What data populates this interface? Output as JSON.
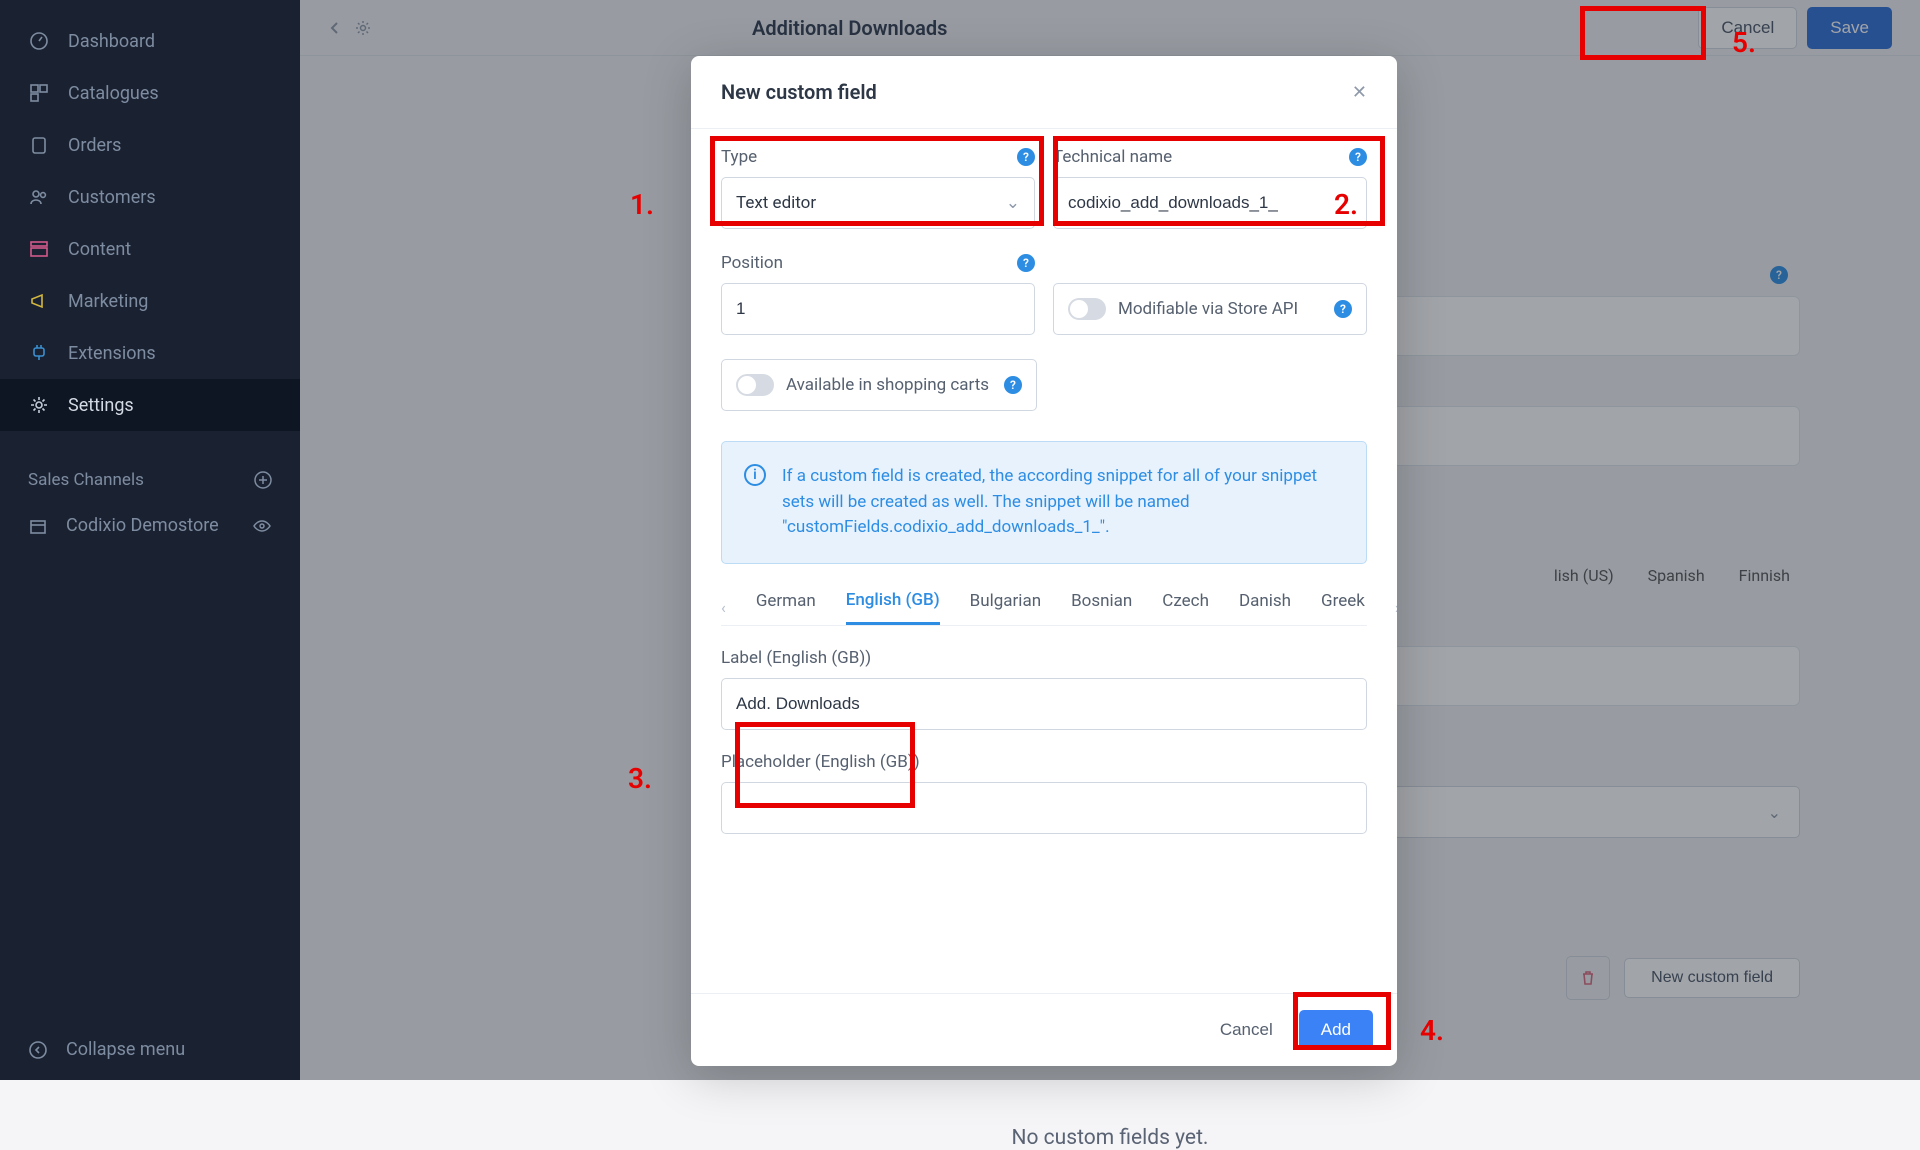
{
  "sidebar": {
    "items": [
      {
        "label": "Dashboard",
        "icon": "dashboard"
      },
      {
        "label": "Catalogues",
        "icon": "grid"
      },
      {
        "label": "Orders",
        "icon": "clipboard"
      },
      {
        "label": "Customers",
        "icon": "users"
      },
      {
        "label": "Content",
        "icon": "layout"
      },
      {
        "label": "Marketing",
        "icon": "megaphone"
      },
      {
        "label": "Extensions",
        "icon": "plug"
      },
      {
        "label": "Settings",
        "icon": "gear",
        "active": true
      }
    ],
    "section_title": "Sales Channels",
    "channel": "Codixio Demostore",
    "collapse": "Collapse menu"
  },
  "topbar": {
    "title": "Additional Downloads",
    "cancel": "Cancel",
    "save": "Save"
  },
  "page": {
    "bg_tabs": [
      "lish (US)",
      "Spanish",
      "Finnish"
    ],
    "no_custom": "No custom fields yet.",
    "new_cf": "New custom field"
  },
  "modal": {
    "title": "New custom field",
    "type_label": "Type",
    "type_value": "Text editor",
    "techname_label": "Technical name",
    "techname_value": "codixio_add_downloads_1_",
    "position_label": "Position",
    "position_value": "1",
    "modifiable": "Modifiable via Store API",
    "shopping_carts": "Available in shopping carts",
    "info": "If a custom field is created, the according snippet for all of your snippet sets will be created as well. The snippet will be named \"customFields.codixio_add_downloads_1_\".",
    "lang_tabs": [
      "German",
      "English (GB)",
      "Bulgarian",
      "Bosnian",
      "Czech",
      "Danish",
      "Greek"
    ],
    "active_lang_index": 1,
    "label_label": "Label (English (GB))",
    "label_value": "Add. Downloads",
    "placeholder_label": "Placeholder (English (GB))",
    "placeholder_value": "",
    "footer_cancel": "Cancel",
    "footer_add": "Add"
  },
  "anno": {
    "n1": "1.",
    "n2": "2.",
    "n3": "3.",
    "n4": "4.",
    "n5": "5."
  }
}
